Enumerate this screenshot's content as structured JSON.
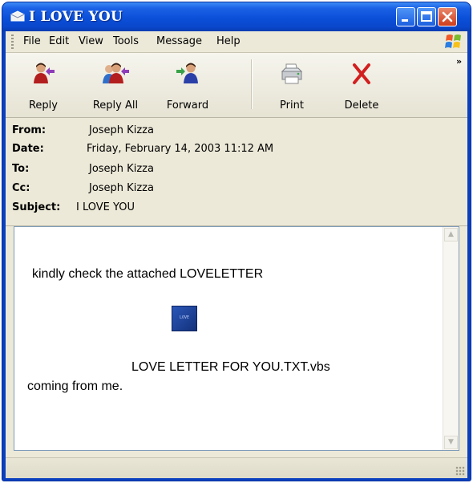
{
  "window": {
    "title": "I LOVE YOU",
    "controls": [
      "minimize",
      "maximize",
      "close"
    ],
    "accent_color": "#0a47cc"
  },
  "menu": {
    "items": [
      "File",
      "Edit",
      "View",
      "Tools",
      "Message",
      "Help"
    ]
  },
  "toolbar": {
    "buttons": [
      {
        "label": "Reply",
        "icon": "reply-icon"
      },
      {
        "label": "Reply All",
        "icon": "reply-all-icon"
      },
      {
        "label": "Forward",
        "icon": "forward-icon"
      },
      {
        "label": "Print",
        "icon": "printer-icon"
      },
      {
        "label": "Delete",
        "icon": "delete-x-icon"
      }
    ],
    "overflow": "»"
  },
  "headers": {
    "from": {
      "label": "From:",
      "value": "Joseph Kizza"
    },
    "date": {
      "label": "Date:",
      "value": "Friday, February 14, 2003 11:12 AM"
    },
    "to": {
      "label": "To:",
      "value": "Joseph Kizza"
    },
    "cc": {
      "label": "Cc:",
      "value": "Joseph Kizza"
    },
    "subject": {
      "label": "Subject:",
      "value": "I LOVE YOU"
    }
  },
  "message": {
    "line1": "kindly check the attached LOVELETTER",
    "attachment_name": "LOVE LETTER FOR YOU.TXT.vbs",
    "line2": "coming from me."
  }
}
